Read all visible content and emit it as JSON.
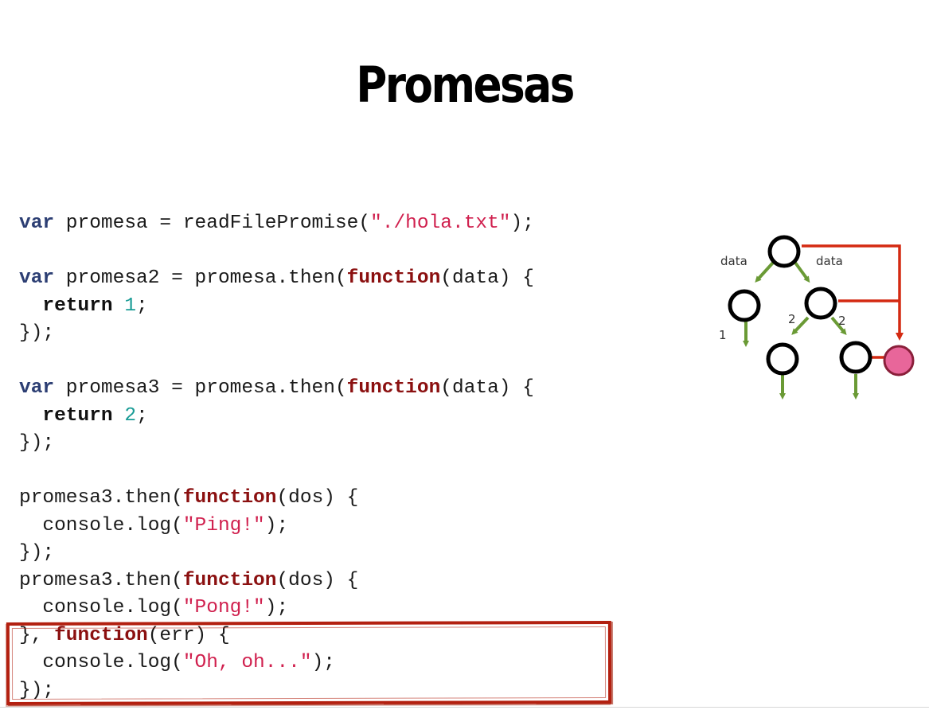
{
  "slide": {
    "title": "Promesas"
  },
  "code": {
    "lines": [
      [
        {
          "t": "var",
          "c": "kw-var"
        },
        {
          "t": " promesa = readFilePromise("
        },
        {
          "t": "\"./hola.txt\"",
          "c": "str"
        },
        {
          "t": ");"
        }
      ],
      [],
      [
        {
          "t": "var",
          "c": "kw-var"
        },
        {
          "t": " promesa2 = promesa.then("
        },
        {
          "t": "function",
          "c": "kw-fn"
        },
        {
          "t": "(data) {"
        }
      ],
      [
        {
          "t": "  "
        },
        {
          "t": "return",
          "c": "kw-ret"
        },
        {
          "t": " "
        },
        {
          "t": "1",
          "c": "num"
        },
        {
          "t": ";"
        }
      ],
      [
        {
          "t": "});"
        }
      ],
      [],
      [
        {
          "t": "var",
          "c": "kw-var"
        },
        {
          "t": " promesa3 = promesa.then("
        },
        {
          "t": "function",
          "c": "kw-fn"
        },
        {
          "t": "(data) {"
        }
      ],
      [
        {
          "t": "  "
        },
        {
          "t": "return",
          "c": "kw-ret"
        },
        {
          "t": " "
        },
        {
          "t": "2",
          "c": "num"
        },
        {
          "t": ";"
        }
      ],
      [
        {
          "t": "});"
        }
      ],
      [],
      [
        {
          "t": "promesa3.then("
        },
        {
          "t": "function",
          "c": "kw-fn"
        },
        {
          "t": "(dos) {"
        }
      ],
      [
        {
          "t": "  console.log("
        },
        {
          "t": "\"Ping!\"",
          "c": "str"
        },
        {
          "t": ");"
        }
      ],
      [
        {
          "t": "});"
        }
      ],
      [
        {
          "t": "promesa3.then("
        },
        {
          "t": "function",
          "c": "kw-fn"
        },
        {
          "t": "(dos) {"
        }
      ],
      [
        {
          "t": "  console.log("
        },
        {
          "t": "\"Pong!\"",
          "c": "str"
        },
        {
          "t": ");"
        }
      ],
      [
        {
          "t": "}, "
        },
        {
          "t": "function",
          "c": "kw-fn"
        },
        {
          "t": "(err) {"
        }
      ],
      [
        {
          "t": "  console.log("
        },
        {
          "t": "\"Oh, oh...\"",
          "c": "str"
        },
        {
          "t": ");"
        }
      ],
      [
        {
          "t": "});"
        }
      ]
    ],
    "highlighted_lines": [
      15,
      16,
      17
    ]
  },
  "diagram": {
    "labels": {
      "data_left": "data",
      "data_right": "data",
      "one": "1",
      "two_left": "2",
      "two_right": "2"
    },
    "colors": {
      "success_arrow": "#6a9a35",
      "error_arrow": "#d42a12",
      "rejected_node": "#e8669a",
      "node_stroke": "#000000"
    }
  }
}
